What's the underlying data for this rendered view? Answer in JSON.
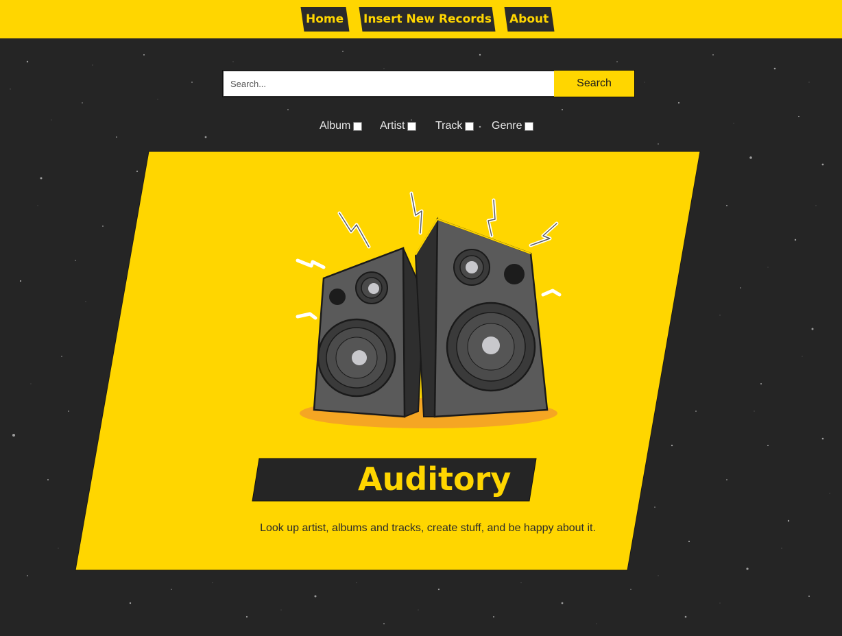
{
  "nav": {
    "items": [
      {
        "label": "Home"
      },
      {
        "label": "Insert New Records"
      },
      {
        "label": "About"
      }
    ]
  },
  "search": {
    "placeholder": "Search...",
    "value": "",
    "button_label": "Search"
  },
  "filters": [
    {
      "label": "Album",
      "checked": false
    },
    {
      "label": "Artist",
      "checked": false
    },
    {
      "label": "Track",
      "checked": false
    },
    {
      "label": "Genre",
      "checked": false
    }
  ],
  "hero": {
    "title": "Auditory",
    "tagline": "Look up artist, albums and tracks, create stuff, and be happy about it.",
    "illustration": "speakers-icon"
  },
  "colors": {
    "accent": "#FFD600",
    "background": "#252525",
    "dark": "#2a2a2a"
  }
}
